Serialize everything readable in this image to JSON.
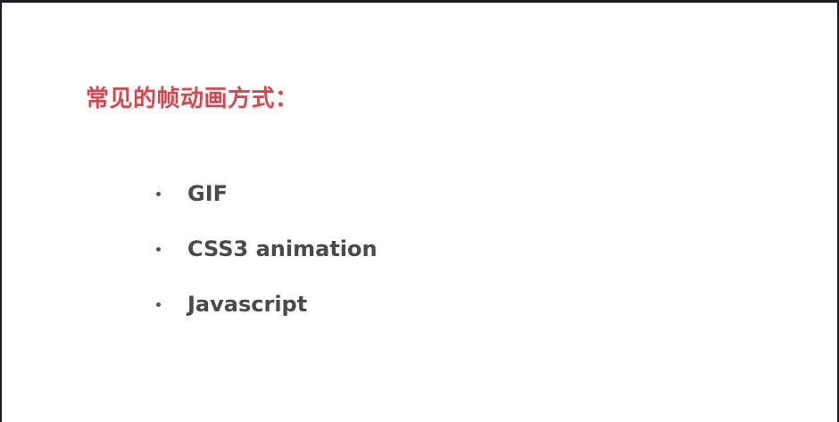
{
  "slide": {
    "title": "常见的帧动画方式：",
    "title_color": "#d9474e",
    "bullet_icon": "bullet-dot-icon",
    "items": [
      {
        "label": "GIF"
      },
      {
        "label": "CSS3 animation"
      },
      {
        "label": "Javascript"
      }
    ]
  }
}
